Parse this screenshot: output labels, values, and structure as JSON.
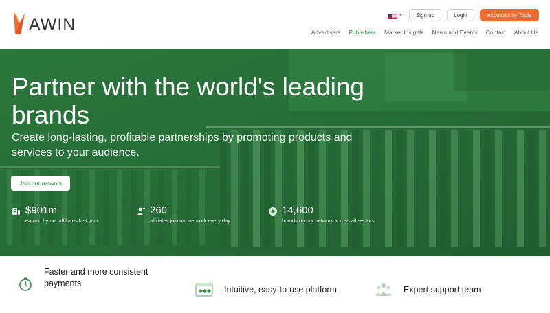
{
  "brand": {
    "name": "AWIN"
  },
  "top_actions": {
    "signup_label": "Sign up",
    "login_label": "Login",
    "accessibility_label": "Accessibility Tools"
  },
  "nav": {
    "items": [
      {
        "label": "Advertisers"
      },
      {
        "label": "Publishers"
      },
      {
        "label": "Market Insights"
      },
      {
        "label": "News and Events"
      },
      {
        "label": "Contact"
      },
      {
        "label": "About Us"
      }
    ],
    "active": "Publishers"
  },
  "hero": {
    "title": "Partner with the world's leading brands",
    "subtitle": "Create long-lasting, profitable partnerships by promoting products and services to your audience.",
    "cta_label": "Join our network"
  },
  "stats": [
    {
      "value": "$901m",
      "caption": "earned by our affiliates last year",
      "icon": "money-stack-icon"
    },
    {
      "value": "260",
      "caption": "affiliates join our network every day",
      "icon": "person-plus-icon"
    },
    {
      "value": "14,600",
      "caption": "brands on our network across all sectors",
      "icon": "brands-icon"
    }
  ],
  "features": [
    {
      "label": "Faster and more consistent payments",
      "icon": "stopwatch-icon"
    },
    {
      "label": "Intuitive, easy-to-use platform",
      "icon": "dashboard-icon"
    },
    {
      "label": "Expert support team",
      "icon": "team-icon"
    }
  ],
  "colors": {
    "accent_orange": "#f26b2e",
    "brand_green": "#2e8b43",
    "hero_overlay": "#2c6b3a"
  }
}
